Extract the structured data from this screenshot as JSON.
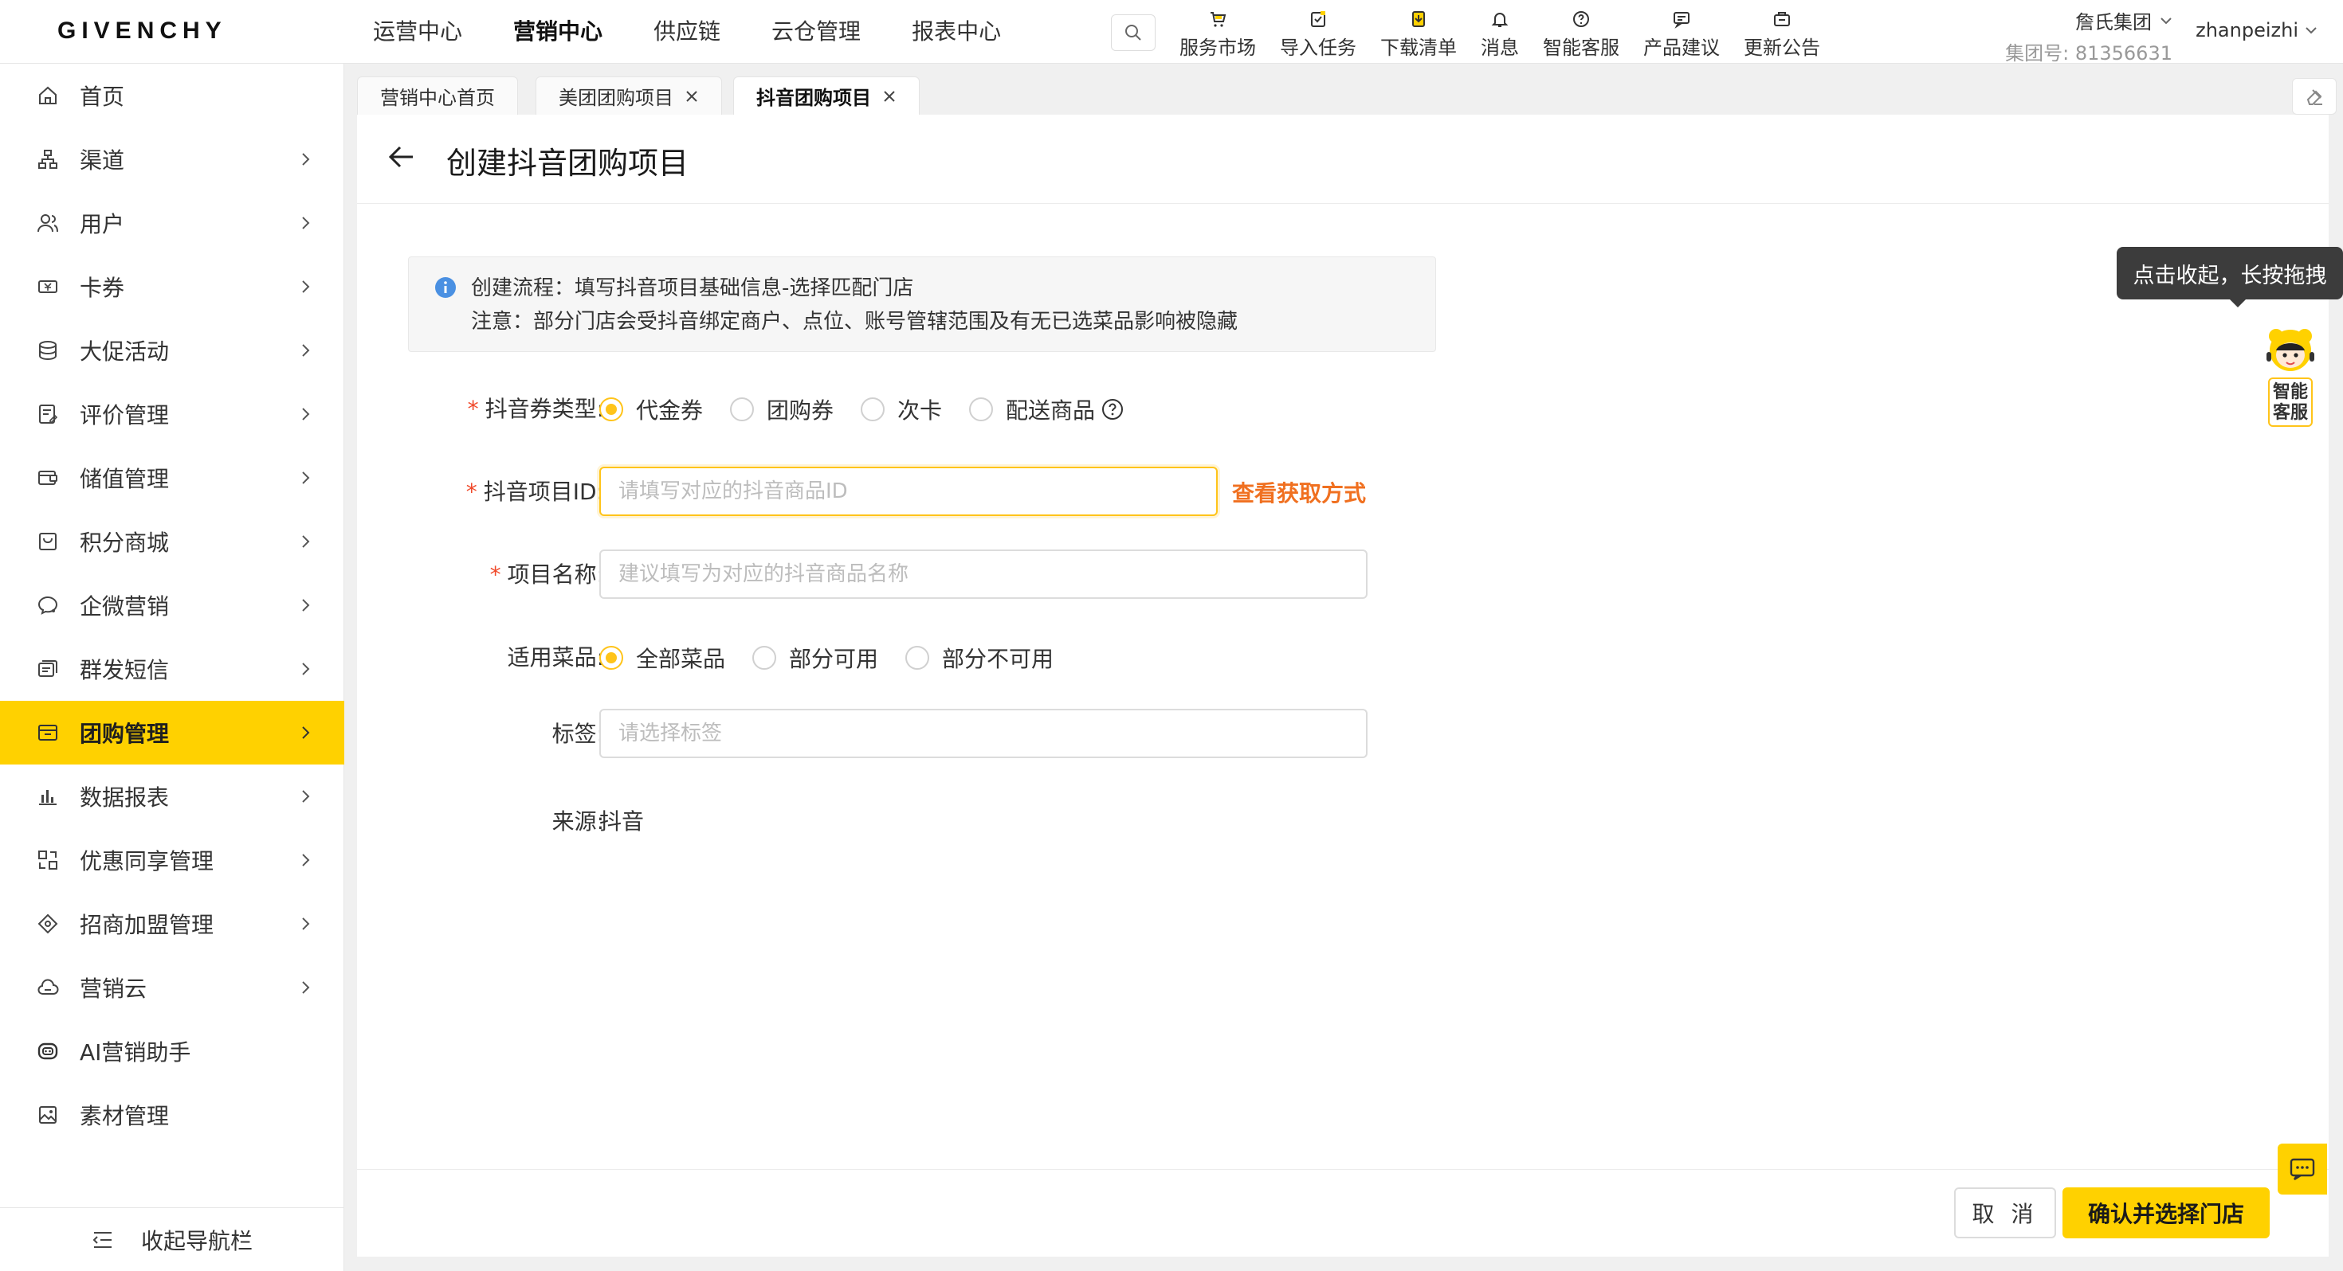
{
  "header": {
    "logo": "GIVENCHY",
    "nav": [
      "运营中心",
      "营销中心",
      "供应链",
      "云仓管理",
      "报表中心"
    ],
    "active_nav": 1,
    "tools": [
      {
        "label": "服务市场",
        "icon": "cart-icon"
      },
      {
        "label": "导入任务",
        "icon": "import-task-icon"
      },
      {
        "label": "下载清单",
        "icon": "download-list-icon"
      },
      {
        "label": "消息",
        "icon": "bell-icon"
      },
      {
        "label": "智能客服",
        "icon": "help-circle-icon"
      },
      {
        "label": "产品建议",
        "icon": "suggestion-icon"
      },
      {
        "label": "更新公告",
        "icon": "announcement-icon"
      }
    ],
    "group_name": "詹氏集团",
    "group_id": "集团号: 81356631",
    "username": "zhanpeizhi"
  },
  "sidebar": {
    "items": [
      {
        "label": "首页",
        "icon": "home-icon",
        "has_arrow": false
      },
      {
        "label": "渠道",
        "icon": "channel-icon",
        "has_arrow": true
      },
      {
        "label": "用户",
        "icon": "users-icon",
        "has_arrow": true
      },
      {
        "label": "卡券",
        "icon": "coupon-icon",
        "has_arrow": true
      },
      {
        "label": "大促活动",
        "icon": "promotion-icon",
        "has_arrow": true
      },
      {
        "label": "评价管理",
        "icon": "review-icon",
        "has_arrow": true
      },
      {
        "label": "储值管理",
        "icon": "stored-value-icon",
        "has_arrow": true
      },
      {
        "label": "积分商城",
        "icon": "points-mall-icon",
        "has_arrow": true
      },
      {
        "label": "企微营销",
        "icon": "wecom-icon",
        "has_arrow": true
      },
      {
        "label": "群发短信",
        "icon": "sms-icon",
        "has_arrow": true
      },
      {
        "label": "团购管理",
        "icon": "group-buy-icon",
        "has_arrow": true,
        "active": true
      },
      {
        "label": "数据报表",
        "icon": "report-icon",
        "has_arrow": true
      },
      {
        "label": "优惠同享管理",
        "icon": "share-icon",
        "has_arrow": true
      },
      {
        "label": "招商加盟管理",
        "icon": "franchise-icon",
        "has_arrow": true
      },
      {
        "label": "营销云",
        "icon": "cloud-icon",
        "has_arrow": true
      },
      {
        "label": "AI营销助手",
        "icon": "ai-assistant-icon",
        "has_arrow": false
      },
      {
        "label": "素材管理",
        "icon": "image-icon",
        "has_arrow": false
      }
    ],
    "collapse_label": "收起导航栏"
  },
  "tabs": [
    {
      "label": "营销中心首页",
      "closable": false
    },
    {
      "label": "美团团购项目",
      "closable": true
    },
    {
      "label": "抖音团购项目",
      "closable": true,
      "active": true
    }
  ],
  "page": {
    "title": "创建抖音团购项目",
    "notice_line1": "创建流程：填写抖音项目基础信息-选择匹配门店",
    "notice_line2": "注意：部分门店会受抖音绑定商户、点位、账号管辖范围及有无已选菜品影响被隐藏"
  },
  "form": {
    "coupon_type": {
      "label": "抖音券类型:",
      "options": [
        "代金券",
        "团购券",
        "次卡",
        "配送商品"
      ],
      "selected": 0
    },
    "project_id": {
      "label": "抖音项目ID:",
      "placeholder": "请填写对应的抖音商品ID",
      "value": "",
      "link": "查看获取方式"
    },
    "project_name": {
      "label": "项目名称:",
      "placeholder": "建议填写为对应的抖音商品名称",
      "value": ""
    },
    "dishes": {
      "label": "适用菜品:",
      "options": [
        "全部菜品",
        "部分可用",
        "部分不可用"
      ],
      "selected": 0
    },
    "tags": {
      "label": "标签:",
      "placeholder": "请选择标签"
    },
    "source": {
      "label": "来源:",
      "value": "抖音"
    }
  },
  "footer": {
    "cancel": "取 消",
    "confirm": "确认并选择门店"
  },
  "floating": {
    "tooltip": "点击收起，长按拖拽",
    "assistant_label": "智能客服"
  },
  "colors": {
    "accent": "#ffd100",
    "radio": "#ffc41a",
    "link": "#f07020",
    "required": "#f0492a"
  }
}
